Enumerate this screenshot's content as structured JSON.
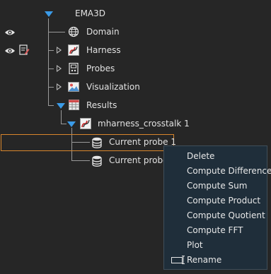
{
  "tree": {
    "root": {
      "label": "EMA3D",
      "icon": "expanded-triangle-icon"
    },
    "items": [
      {
        "label": "Domain",
        "icon": "globe-icon"
      },
      {
        "label": "Harness",
        "icon": "harness-icon"
      },
      {
        "label": "Probes",
        "icon": "probe-device-icon"
      },
      {
        "label": "Visualization",
        "icon": "image-icon"
      },
      {
        "label": "Results",
        "icon": "table-icon"
      }
    ],
    "result_child": {
      "label": "mharness_crosstalk 1",
      "icon": "harness-icon"
    },
    "probes": [
      {
        "label": "Current probe 1",
        "icon": "database-icon",
        "selected": true
      },
      {
        "label": "Current probe 2",
        "icon": "database-icon",
        "selected": false
      }
    ]
  },
  "gutter_icons": [
    "eye-icon",
    "eye-icon",
    "edit-document-icon"
  ],
  "context_menu": {
    "items": [
      {
        "label": "Delete"
      },
      {
        "label": "Compute Difference"
      },
      {
        "label": "Compute Sum"
      },
      {
        "label": "Compute Product"
      },
      {
        "label": "Compute Quotient"
      },
      {
        "label": "Compute FFT"
      },
      {
        "label": "Plot"
      },
      {
        "label": "Rename",
        "icon": "rename-icon"
      }
    ]
  },
  "colors": {
    "background": "#262626",
    "menu_background": "#1f2e3a",
    "selection_border": "#d9862c",
    "expander_blue": "#3b9be8"
  }
}
